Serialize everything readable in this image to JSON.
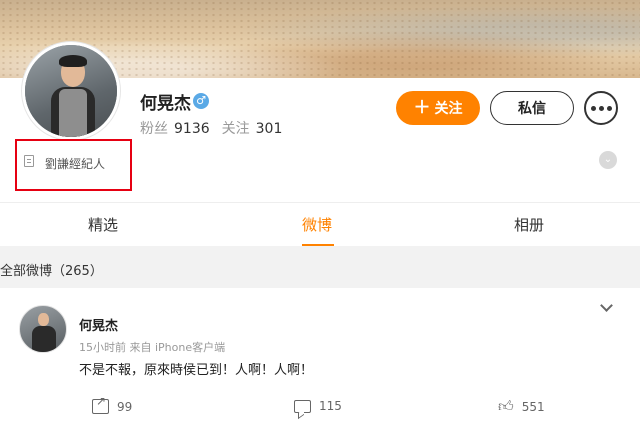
{
  "profile": {
    "name": "何晃杰",
    "gender_icon": "male-badge-icon",
    "stats": {
      "followers_label": "粉丝",
      "followers_value": "9136",
      "following_label": "关注",
      "following_value": "301"
    },
    "bio": "劉謙經紀人",
    "buttons": {
      "follow": "关注",
      "follow_icon": "＋",
      "message": "私信"
    },
    "expand_icon": "⌄"
  },
  "tabs": [
    "精选",
    "微博",
    "相册"
  ],
  "active_tab": "微博",
  "section": {
    "title": "全部微博（265）"
  },
  "post": {
    "author": "何晃杰",
    "meta": "15小时前  来自 iPhone客户端",
    "text": "不是不報，原來時侯已到！人啊！人啊！",
    "actions": {
      "reposts": "99",
      "comments": "115",
      "likes": "551"
    }
  },
  "colors": {
    "accent": "#ff8200",
    "highlight_box": "#e60012",
    "section_bg": "#f2f2f2"
  }
}
